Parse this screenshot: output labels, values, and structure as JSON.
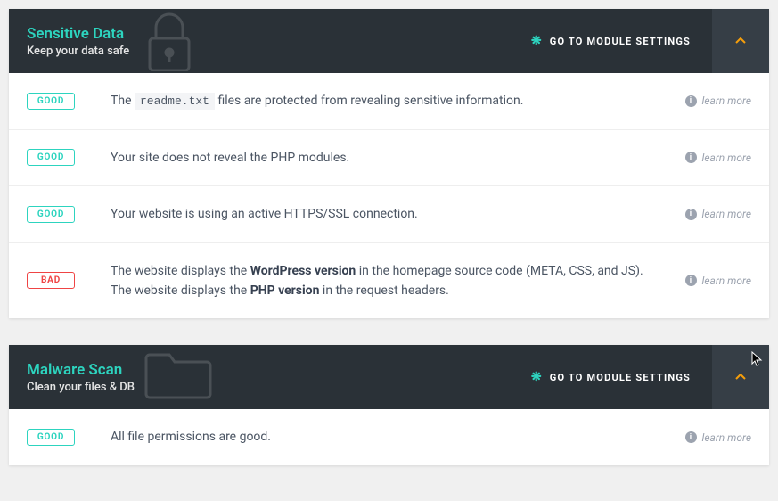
{
  "modules": [
    {
      "title": "Sensitive Data",
      "subtitle": "Keep your data safe",
      "settings_label": "GO TO MODULE SETTINGS",
      "icon": "lock",
      "rows": [
        {
          "status": "GOOD",
          "html": "The <code>readme.txt</code> files are protected from revealing sensitive information.",
          "learn": "learn more"
        },
        {
          "status": "GOOD",
          "html": "Your site does not reveal the PHP modules.",
          "learn": "learn more"
        },
        {
          "status": "GOOD",
          "html": "Your website is using an active HTTPS/SSL connection.",
          "learn": "learn more"
        },
        {
          "status": "BAD",
          "html": "The website displays the <strong>WordPress version</strong> in the homepage source code (META, CSS, and JS).<br>The website displays the <strong>PHP version</strong> in the request headers.",
          "learn": "learn more"
        }
      ]
    },
    {
      "title": "Malware Scan",
      "subtitle": "Clean your files & DB",
      "settings_label": "GO TO MODULE SETTINGS",
      "icon": "folder",
      "rows": [
        {
          "status": "GOOD",
          "html": "All file permissions are good.",
          "learn": "learn more"
        }
      ]
    }
  ]
}
